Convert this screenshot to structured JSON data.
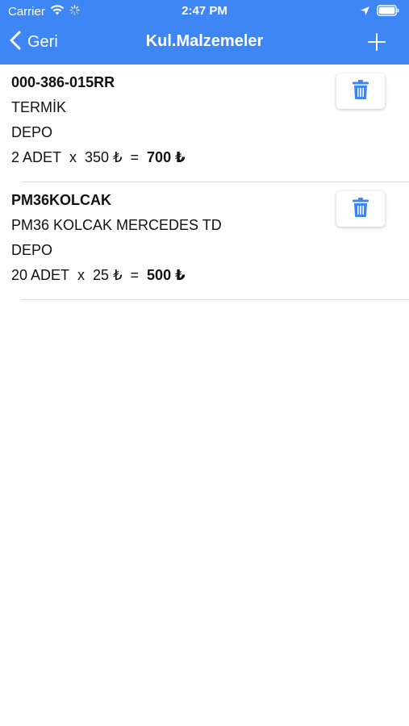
{
  "status_bar": {
    "carrier": "Carrier",
    "time": "2:47 PM"
  },
  "nav": {
    "back_label": "Geri",
    "title": "Kul.Malzemeler",
    "accent_color": "#3f86f5"
  },
  "items": [
    {
      "code": "000-386-015RR",
      "name": "TERMİK",
      "warehouse": "DEPO",
      "quantity": "2 ADET",
      "times": "x",
      "unit_price": "350 ₺",
      "equals": "=",
      "total": "700 ₺"
    },
    {
      "code": "PM36KOLCAK",
      "name": "PM36 KOLCAK MERCEDES TD",
      "warehouse": "DEPO",
      "quantity": "20 ADET",
      "times": "x",
      "unit_price": "25 ₺",
      "equals": "=",
      "total": "500 ₺"
    }
  ],
  "icons": {
    "delete": "trash-icon",
    "add": "plus-icon",
    "back": "chevron-left-icon",
    "wifi": "wifi-icon",
    "activity": "activity-spinner-icon",
    "location": "location-arrow-icon",
    "battery": "battery-icon",
    "delete_color": "#3f86f5"
  }
}
